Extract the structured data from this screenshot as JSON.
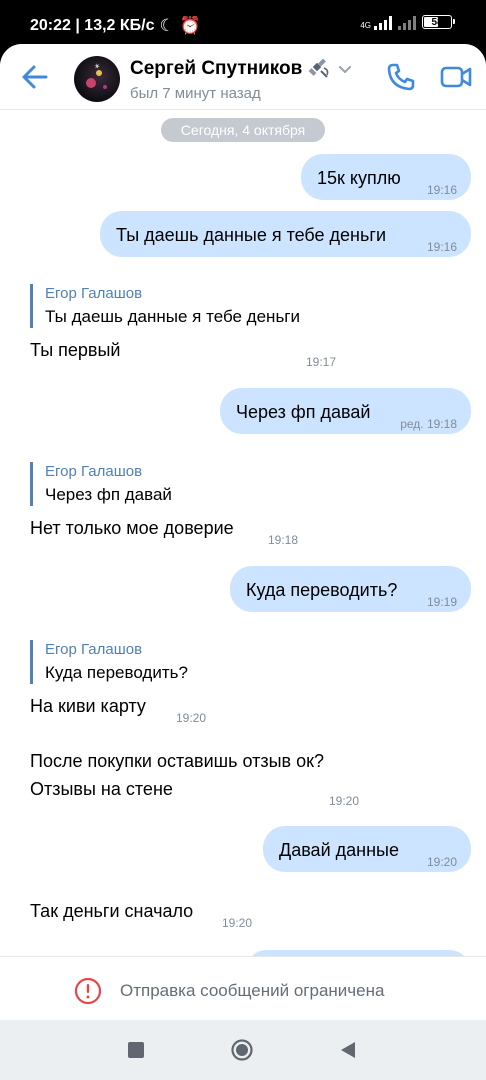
{
  "status_bar": {
    "time_data": "20:22 | 13,2 КБ/с",
    "network": "4G",
    "battery": "58",
    "battery_level": 0.58
  },
  "header": {
    "contact_name": "Сергей Спутников",
    "last_seen": "был 7 минут назад",
    "icons": [
      "back-arrow-icon",
      "satellite-icon",
      "chevron-down-icon",
      "phone-icon",
      "video-camera-icon"
    ]
  },
  "date_separator": "Сегодня, 4 октября",
  "messages": [
    {
      "dir": "out",
      "text": "15к куплю",
      "time": "19:16"
    },
    {
      "dir": "out",
      "text": "Ты даешь данные я тебе деньги",
      "time": "19:16"
    },
    {
      "dir": "in",
      "reply_author": "Егор Галашов",
      "reply_text": "Ты даешь данные я тебе деньги",
      "text": "Ты первый",
      "time": "19:17"
    },
    {
      "dir": "out",
      "text": "Через фп давай",
      "time": "ред. 19:18"
    },
    {
      "dir": "in",
      "reply_author": "Егор Галашов",
      "reply_text": "Через фп давай",
      "text": "Нет только мое доверие",
      "time": "19:18"
    },
    {
      "dir": "out",
      "text": "Куда переводить?",
      "time": "19:19"
    },
    {
      "dir": "in",
      "reply_author": "Егор Галашов",
      "reply_text": "Куда переводить?",
      "text": "На киви карту",
      "time": "19:20"
    },
    {
      "dir": "in",
      "line1": "После покупки оставишь отзыв ок?",
      "line2": "Отзывы на стене",
      "time": "19:20"
    },
    {
      "dir": "out",
      "text": "Давай данные",
      "time": "19:20"
    },
    {
      "dir": "in",
      "text": "Так деньги сначало",
      "time": "19:20"
    }
  ],
  "restricted_notice": "Отправка сообщений ограничена",
  "colors": {
    "accent": "#3f8ae0",
    "outgoing_bubble": "#cce4ff",
    "reply_author": "#5181b8",
    "warning": "#e64646",
    "secondary_text": "#818c99"
  }
}
